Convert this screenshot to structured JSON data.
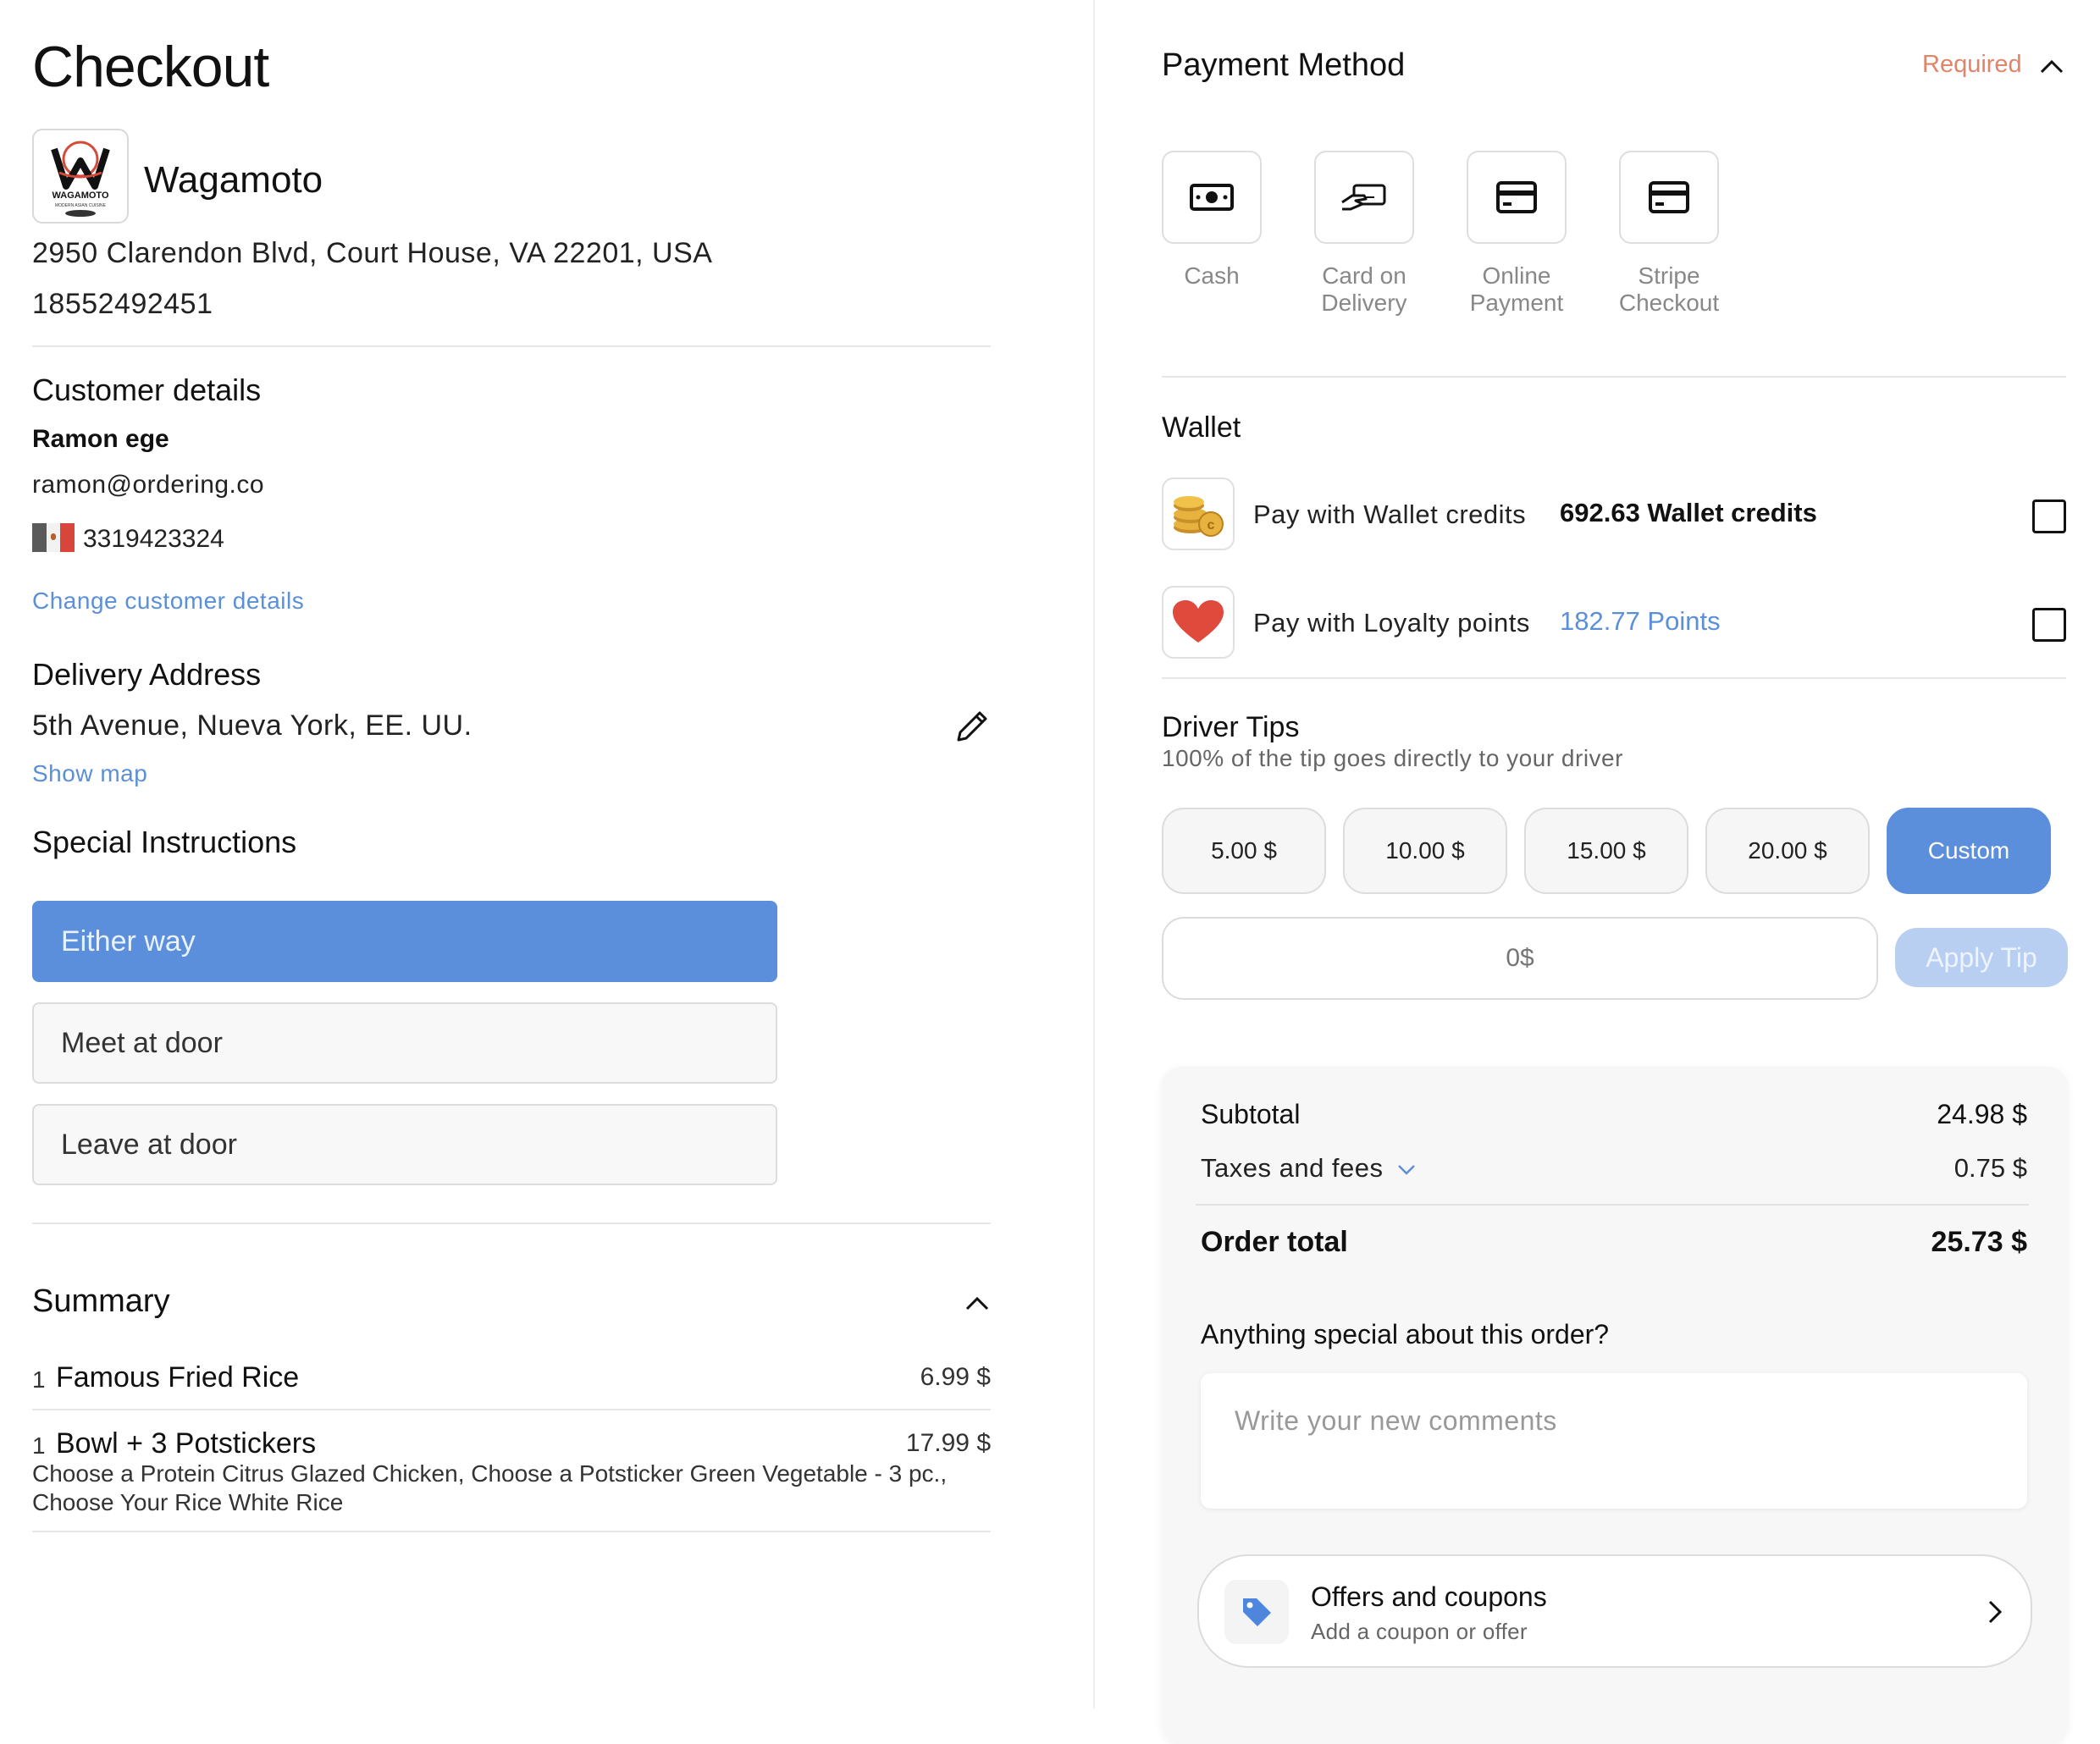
{
  "checkout": {
    "title": "Checkout",
    "business": {
      "name": "Wagamoto",
      "logo_text": "WAGAMOTO",
      "logo_subtext": "MODERN ASIAN CUISINE",
      "address": "2950 Clarendon Blvd, Court House, VA 22201, USA",
      "phone": "18552492451"
    }
  },
  "customer": {
    "heading": "Customer details",
    "name": "Ramon ege",
    "email": "ramon@ordering.co",
    "phone": "3319423324",
    "change_link": "Change customer details"
  },
  "delivery": {
    "heading": "Delivery Address",
    "address": "5th Avenue, Nueva York, EE. UU.",
    "show_map": "Show map"
  },
  "instructions": {
    "heading": "Special Instructions",
    "options": [
      "Either way",
      "Meet at door",
      "Leave at door"
    ],
    "selected": "Either way"
  },
  "summary": {
    "heading": "Summary",
    "items": [
      {
        "qty": "1",
        "name": "Famous Fried Rice",
        "price": "6.99 $",
        "options": ""
      },
      {
        "qty": "1",
        "name": "Bowl + 3 Potstickers",
        "price": "17.99 $",
        "options": "Choose a Protein Citrus Glazed Chicken, Choose a Potsticker Green Vegetable - 3 pc., Choose Your Rice White Rice"
      }
    ]
  },
  "payment": {
    "heading": "Payment Method",
    "required": "Required",
    "methods": [
      {
        "label": "Cash",
        "icon": "cash-icon"
      },
      {
        "label": "Card on Delivery",
        "icon": "card-on-delivery-icon"
      },
      {
        "label": "Online Payment",
        "icon": "credit-card-icon"
      },
      {
        "label": "Stripe Checkout",
        "icon": "credit-card-icon"
      }
    ]
  },
  "wallet": {
    "heading": "Wallet",
    "credits_label": "Pay with Wallet credits",
    "credits_value": "692.63 Wallet credits",
    "loyalty_label": "Pay with Loyalty points",
    "loyalty_value": "182.77 Points"
  },
  "tips": {
    "heading": "Driver Tips",
    "subtitle": "100% of the tip goes directly to your driver",
    "options": [
      "5.00 $",
      "10.00 $",
      "15.00 $",
      "20.00 $",
      "Custom"
    ],
    "selected": "Custom",
    "input_placeholder": "0$",
    "apply_label": "Apply Tip"
  },
  "totals": {
    "subtotal_label": "Subtotal",
    "subtotal_value": "24.98 $",
    "taxes_label": "Taxes and fees",
    "taxes_value": "0.75 $",
    "total_label": "Order total",
    "total_value": "25.73 $"
  },
  "comments": {
    "question": "Anything special about this order?",
    "placeholder": "Write your new comments"
  },
  "offers": {
    "title": "Offers and coupons",
    "subtitle": "Add a coupon or offer"
  },
  "colors": {
    "accent": "#5b8fdc",
    "required": "#e0846a",
    "link": "#5b8fd8"
  }
}
